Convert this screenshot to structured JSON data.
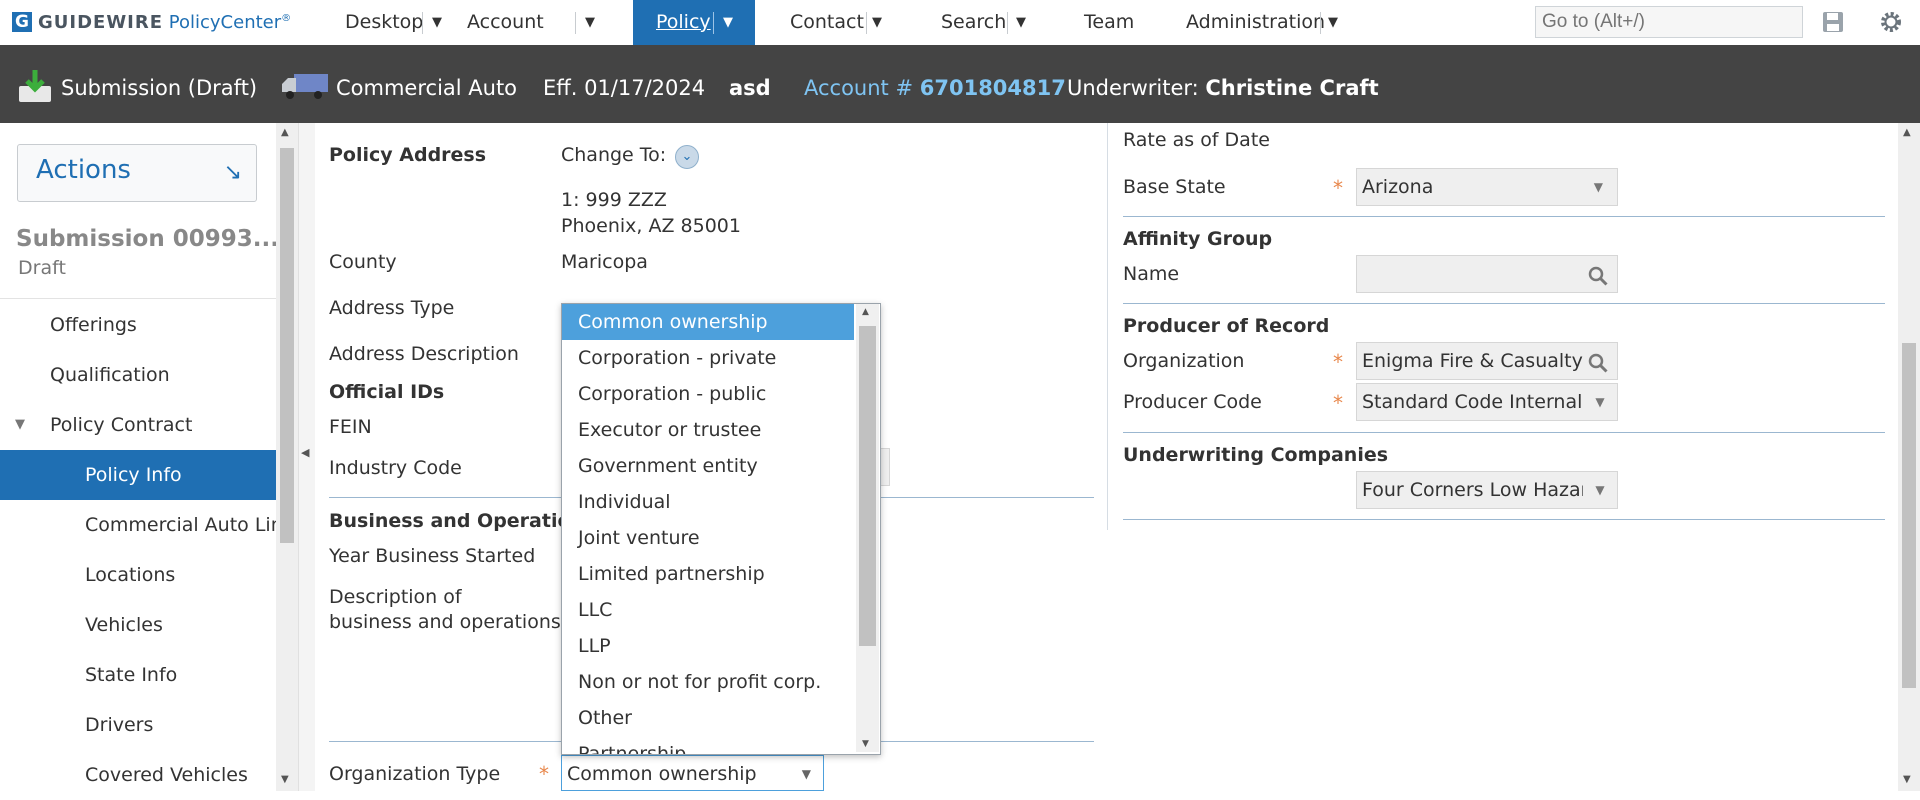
{
  "brand": {
    "product": "GUIDEWIRE",
    "app": "PolicyCenter",
    "mark": "G"
  },
  "nav": {
    "desktop": "Desktop",
    "account": "Account",
    "policy": "Policy",
    "contact": "Contact",
    "search": "Search",
    "team": "Team",
    "administration": "Administration",
    "goto_placeholder": "Go to (Alt+/)"
  },
  "header": {
    "submission": "Submission (Draft)",
    "line": "Commercial Auto",
    "effective": "Eff. 01/17/2024",
    "insured": "asd",
    "account_label": "Account #",
    "account_number": "6701804817",
    "underwriter_label": "Underwriter:",
    "underwriter_name": "Christine Craft"
  },
  "sidebar": {
    "actions": "Actions",
    "submission_title": "Submission 00993...",
    "status": "Draft",
    "items": [
      "Offerings",
      "Qualification",
      "Policy Contract",
      "Policy Info",
      "Commercial Auto Lin",
      "Locations",
      "Vehicles",
      "State Info",
      "Drivers",
      "Covered Vehicles"
    ]
  },
  "form": {
    "policy_address": "Policy Address",
    "change_to": "Change To:",
    "address_line1": "1: 999 ZZZ",
    "address_line2": "Phoenix, AZ 85001",
    "county_label": "County",
    "county_value": "Maricopa",
    "address_type_label": "Address Type",
    "address_description_label": "Address Description",
    "official_ids": "Official IDs",
    "fein_label": "FEIN",
    "industry_code_label": "Industry Code",
    "business_ops": "Business and Operations",
    "year_started_label": "Year Business Started",
    "description_label_1": "Description of",
    "description_label_2": "business and operations",
    "org_type_label": "Organization Type",
    "org_type_value": "Common ownership"
  },
  "org_type_options": [
    "Common ownership",
    "Corporation - private",
    "Corporation - public",
    "Executor or trustee",
    "Government entity",
    "Individual",
    "Joint venture",
    "Limited partnership",
    "LLC",
    "LLP",
    "Non or not for profit corp.",
    "Other",
    "Partnership"
  ],
  "right": {
    "rate_as_of": "Rate as of Date",
    "base_state_label": "Base State",
    "base_state_value": "Arizona",
    "affinity_group": "Affinity Group",
    "name_label": "Name",
    "producer_of_record": "Producer of Record",
    "organization_label": "Organization",
    "organization_value": "Enigma Fire & Casualty",
    "producer_code_label": "Producer Code",
    "producer_code_value": "Standard Code Internal I",
    "underwriting_companies": "Underwriting Companies",
    "uw_company_value": "Four Corners Low Hazar"
  },
  "colors": {
    "brand_blue": "#1f6fb3",
    "header_bg": "#444444",
    "account_link": "#7fc4f2",
    "required": "#e8874b",
    "highlight": "#4da0dc"
  }
}
